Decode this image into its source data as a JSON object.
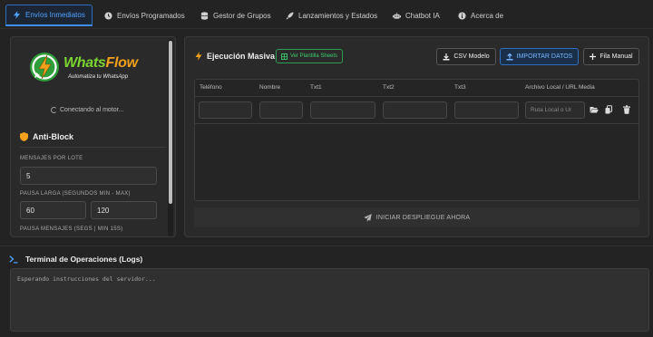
{
  "tabs": [
    {
      "label": "Envíos Inmediatos",
      "icon": "lightning-icon",
      "active": true
    },
    {
      "label": "Envíos Programados",
      "icon": "clock-icon",
      "active": false
    },
    {
      "label": "Gestor de Grupos",
      "icon": "database-icon",
      "active": false
    },
    {
      "label": "Lanzamientos y Estados",
      "icon": "rocket-icon",
      "active": false
    },
    {
      "label": "Chatbot IA",
      "icon": "robot-icon",
      "active": false
    },
    {
      "label": "Acerca de",
      "icon": "info-icon",
      "active": false
    }
  ],
  "sidebar": {
    "logo": {
      "brand_a": "Whats",
      "brand_b": "Flow",
      "tagline": "Automatiza tu WhatsApp"
    },
    "status": "Conectando al motor...",
    "antiblock": {
      "title": "Anti-Block",
      "batch_label": "MENSAJES POR LOTE",
      "batch_value": "5",
      "long_pause_label": "PAUSA LARGA (SEGUNDOS MIN - MAX)",
      "long_pause_min": "60",
      "long_pause_max": "120",
      "msg_pause_label": "PAUSA MENSAJES (SEGS | MIN 15S)"
    }
  },
  "main": {
    "title": "Ejecución Masiva",
    "sheets_button": "Ver Plantilla Sheets",
    "csv_button": "CSV Modelo",
    "import_button": "IMPORTAR DATOS",
    "add_row_button": "Fila Manual",
    "columns": [
      "Teléfono",
      "Nombre",
      "Txt1",
      "Txt2",
      "Txt3",
      "Archivo Local / URL Media"
    ],
    "row": {
      "media_placeholder": "Ruta Local o Ur"
    },
    "launch_button": "INICIAR DESPLIEGUE AHORA"
  },
  "terminal": {
    "title": "Terminal de Operaciones (Logs)",
    "log": "Esperando instrucciones del servidor..."
  },
  "colors": {
    "accent": "#3d8ef0",
    "green": "#3fcb70",
    "orange": "#f3a11a",
    "background": "#232323"
  }
}
